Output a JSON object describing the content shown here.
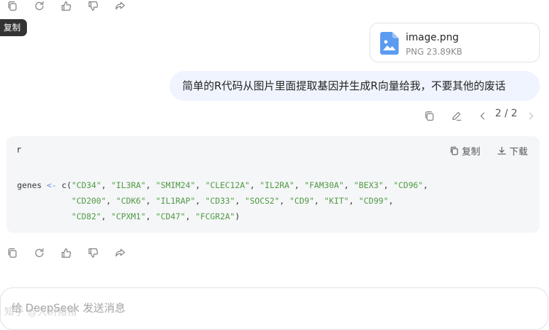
{
  "top_actions": {
    "icons": [
      "copy-icon",
      "regenerate-icon",
      "thumbs-up-icon",
      "thumbs-down-icon",
      "share-icon"
    ],
    "tooltip": "复制"
  },
  "attachment": {
    "file_name": "image.png",
    "file_meta": "PNG 23.89KB",
    "icon": "image-file-icon",
    "icon_color": "#5b9bf0"
  },
  "user_message": {
    "text": "简单的R代码从图片里面提取基因并生成R向量给我，不要其他的废话",
    "background": "#eff4ff"
  },
  "message_controls": {
    "pager": "2 / 2"
  },
  "code_block": {
    "language": "r",
    "copy_label": "复制",
    "download_label": "下载",
    "variable": "genes",
    "assign_op": "<-",
    "func": "c",
    "genes": [
      "CD34",
      "IL3RA",
      "SMIM24",
      "CLEC12A",
      "IL2RA",
      "FAM30A",
      "BEX3",
      "CD96",
      "CD200",
      "CDK6",
      "IL1RAP",
      "CD33",
      "SOCS2",
      "CD9",
      "KIT",
      "CD99",
      "CD82",
      "CPXM1",
      "CD47",
      "FCGR2A"
    ],
    "line_breaks_after": [
      8,
      16
    ],
    "colors": {
      "string": "#4f9a44",
      "operator": "#6a8fd9",
      "block_bg": "#f5f6f8"
    }
  },
  "bottom_actions": {
    "icons": [
      "copy-icon",
      "regenerate-icon",
      "thumbs-up-icon",
      "thumbs-down-icon",
      "share-icon"
    ]
  },
  "composer": {
    "placeholder": "给 DeepSeek 发送消息",
    "watermark": "知乎 @大树猪猪"
  }
}
